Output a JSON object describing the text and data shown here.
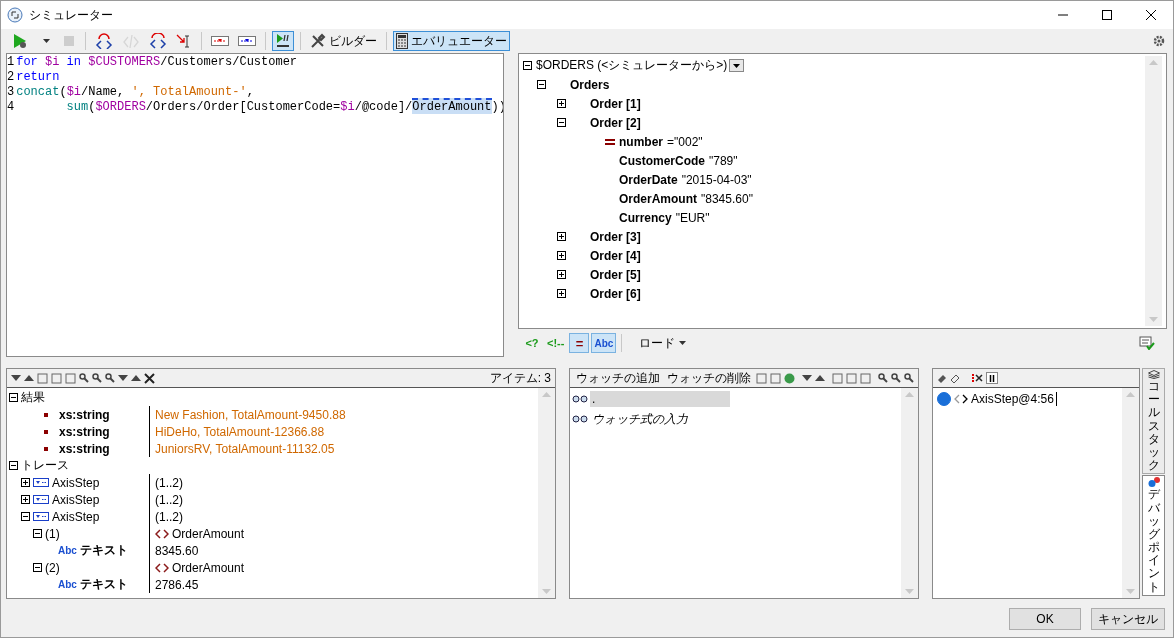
{
  "window": {
    "title": "シミュレーター"
  },
  "toolbar": {
    "items": [
      {
        "kind": "run",
        "selected": false,
        "disabled": false
      },
      {
        "kind": "caret",
        "selected": false,
        "disabled": false
      },
      {
        "kind": "stop",
        "selected": false,
        "disabled": true
      },
      {
        "kind": "separator"
      },
      {
        "kind": "step_into",
        "selected": false,
        "disabled": false
      },
      {
        "kind": "step_over",
        "selected": false,
        "disabled": true
      },
      {
        "kind": "step_out",
        "selected": false,
        "disabled": false
      },
      {
        "kind": "run_to_cursor",
        "selected": false,
        "disabled": false
      },
      {
        "kind": "separator"
      },
      {
        "kind": "breakpoint",
        "selected": false,
        "disabled": false
      },
      {
        "kind": "tracepoint",
        "selected": false,
        "disabled": false
      },
      {
        "kind": "separator"
      },
      {
        "kind": "step_mode",
        "selected": true,
        "disabled": false
      },
      {
        "kind": "separator"
      },
      {
        "kind": "builder",
        "label": "ビルダー",
        "selected": false,
        "disabled": false
      },
      {
        "kind": "separator"
      },
      {
        "kind": "evaluator",
        "label": "エバリュエーター",
        "selected": true,
        "disabled": false
      }
    ]
  },
  "editor": {
    "lines": [
      {
        "number": "1",
        "tokens": [
          {
            "kind": "keyword",
            "text": "for "
          },
          {
            "kind": "variable",
            "text": "$i"
          },
          {
            "kind": "keyword",
            "text": " in "
          },
          {
            "kind": "variable",
            "text": "$CUSTOMERS"
          },
          {
            "kind": "plain",
            "text": "/Customers/Customer"
          }
        ]
      },
      {
        "number": "2",
        "tokens": [
          {
            "kind": "keyword",
            "text": "return"
          }
        ]
      },
      {
        "number": "3",
        "tokens": [
          {
            "kind": "function",
            "text": "concat"
          },
          {
            "kind": "plain",
            "text": "("
          },
          {
            "kind": "variable",
            "text": "$i"
          },
          {
            "kind": "plain",
            "text": "/Name, "
          },
          {
            "kind": "string",
            "text": "', TotalAmount-'"
          },
          {
            "kind": "plain",
            "text": ","
          }
        ]
      },
      {
        "number": "4",
        "tokens": [
          {
            "kind": "function",
            "text": "       sum"
          },
          {
            "kind": "plain",
            "text": "("
          },
          {
            "kind": "variable",
            "text": "$ORDERS"
          },
          {
            "kind": "plain",
            "text": "/Orders/Order[CustomerCode="
          },
          {
            "kind": "variable",
            "text": "$i"
          },
          {
            "kind": "plain",
            "text": "/@code]/"
          },
          {
            "kind": "selection",
            "text": "OrderAmount"
          },
          {
            "kind": "plain",
            "text": "))"
          }
        ]
      }
    ]
  },
  "source_tree": {
    "root": {
      "label": "$ORDERS",
      "source": "(<シミュレーターから>)",
      "expanded": true,
      "children": [
        {
          "kind": "element",
          "name": "Orders",
          "expanded": true,
          "children": [
            {
              "kind": "element",
              "name": "Order [1]",
              "expanded": false
            },
            {
              "kind": "element",
              "name": "Order [2]",
              "expanded": true,
              "children": [
                {
                  "kind": "attribute",
                  "name": "number",
                  "value": "=\"002\""
                },
                {
                  "kind": "leaf",
                  "name": "CustomerCode",
                  "value": "\"789\""
                },
                {
                  "kind": "leaf",
                  "name": "OrderDate",
                  "value": "\"2015-04-03\""
                },
                {
                  "kind": "leaf",
                  "name": "OrderAmount",
                  "value": "\"8345.60\""
                },
                {
                  "kind": "leaf",
                  "name": "Currency",
                  "value": "\"EUR\""
                }
              ]
            },
            {
              "kind": "element",
              "name": "Order [3]",
              "expanded": false
            },
            {
              "kind": "element",
              "name": "Order [4]",
              "expanded": false
            },
            {
              "kind": "element",
              "name": "Order [5]",
              "expanded": false
            },
            {
              "kind": "element",
              "name": "Order [6]",
              "expanded": false
            }
          ]
        }
      ]
    },
    "toggles": [
      {
        "label": "<?",
        "selected": false
      },
      {
        "label": "<!--",
        "selected": false
      },
      {
        "label": "=",
        "selected": true
      },
      {
        "label": "Abc",
        "selected": true
      }
    ],
    "load_button": "ロード"
  },
  "results": {
    "count": "アイテム: 3",
    "tree": [
      {
        "kind": "group",
        "label": "結果",
        "expanded": true,
        "children": [
          {
            "kind": "item",
            "label": "xs:string",
            "value": "New Fashion, TotalAmount-9450.88"
          },
          {
            "kind": "item",
            "label": "xs:string",
            "value": "HiDeHo, TotalAmount-12366.88"
          },
          {
            "kind": "item",
            "label": "xs:string",
            "value": "JuniorsRV, TotalAmount-11132.05"
          }
        ]
      },
      {
        "kind": "group",
        "label": "トレース",
        "expanded": true,
        "children": [
          {
            "kind": "axis_step",
            "label": "AxisStep",
            "value": "(1..2)",
            "expanded": false
          },
          {
            "kind": "axis_step",
            "label": "AxisStep",
            "value": "(1..2)",
            "expanded": false
          },
          {
            "kind": "axis_step",
            "label": "AxisStep",
            "value": "(1..2)",
            "expanded": true,
            "children": [
              {
                "kind": "node",
                "label": "(1)",
                "value": "OrderAmount",
                "expanded": true,
                "children": [
                  {
                    "kind": "text",
                    "badge": "Abc",
                    "label": "テキスト",
                    "value": "8345.60"
                  }
                ]
              },
              {
                "kind": "node",
                "label": "(2)",
                "value": "OrderAmount",
                "expanded": true,
                "children": [
                  {
                    "kind": "text",
                    "badge": "Abc",
                    "label": "テキスト",
                    "value": "2786.45"
                  }
                ]
              }
            ]
          }
        ]
      }
    ]
  },
  "watch": {
    "add_button": "ウォッチの追加",
    "remove_button": "ウォッチの削除",
    "expressions": [
      {
        "text": "."
      }
    ],
    "placeholder": "ウォッチ式の入力"
  },
  "debug_points": {
    "items": [
      {
        "label": "AxisStep@4:56",
        "enabled": true
      }
    ]
  },
  "side_tabs": [
    {
      "label": "コールスタック",
      "selected": false
    },
    {
      "label": "デバッグポイント",
      "selected": true
    }
  ],
  "buttons": {
    "ok": "OK",
    "cancel": "キャンセル"
  }
}
